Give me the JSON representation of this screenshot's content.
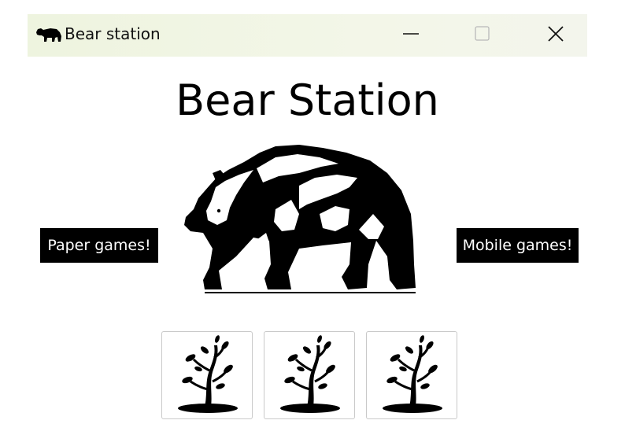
{
  "window": {
    "title": "Bear station",
    "app_icon": "bear-icon",
    "controls": {
      "minimize_icon": "minimize-icon",
      "maximize_icon": "maximize-icon",
      "close_icon": "close-icon"
    }
  },
  "main": {
    "heading": "Bear Station",
    "illustration": "bear-illustration",
    "left_button_label": "Paper games!",
    "right_button_label": "Mobile games!",
    "tiles": [
      {
        "icon": "tree-icon"
      },
      {
        "icon": "tree-icon"
      },
      {
        "icon": "tree-icon"
      }
    ]
  },
  "colors": {
    "titlebar": "#eef4df",
    "button_bg": "#000000",
    "button_text": "#ffffff",
    "tile_border": "#c9c9c9"
  }
}
